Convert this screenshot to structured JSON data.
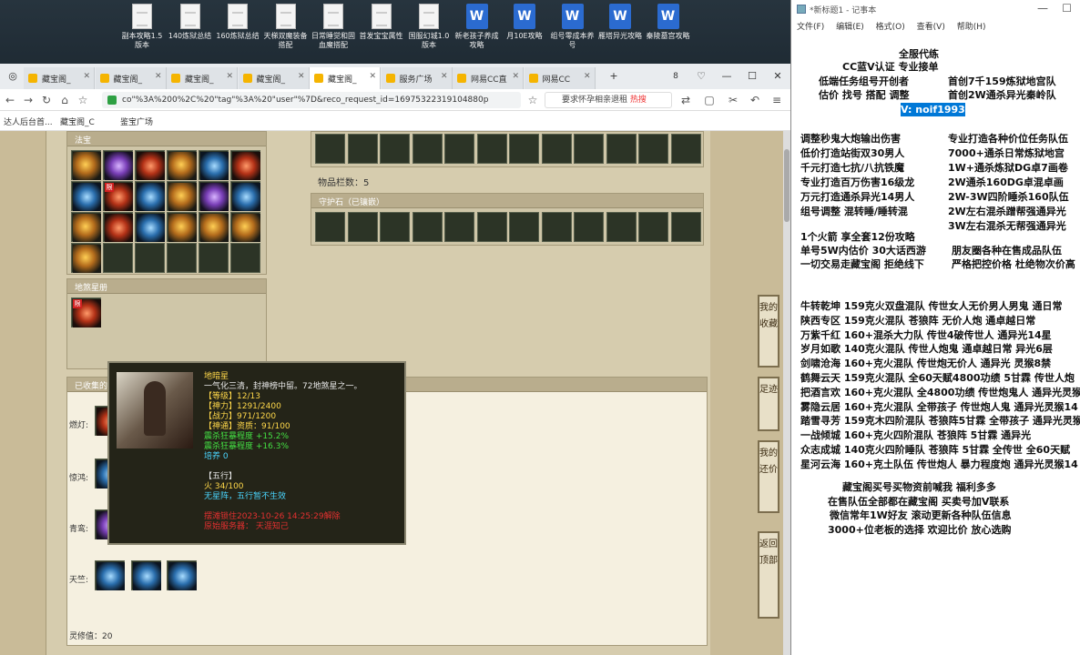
{
  "desktop": {
    "icons": [
      {
        "label": "副本攻略1.5版本",
        "type": "doc"
      },
      {
        "label": "140炼狱总结",
        "type": "doc"
      },
      {
        "label": "160炼狱总结",
        "type": "doc"
      },
      {
        "label": "天梯双魔装备搭配",
        "type": "doc"
      },
      {
        "label": "日常睡觉和固血魔搭配",
        "type": "doc"
      },
      {
        "label": "首发宝宝属性",
        "type": "doc"
      },
      {
        "label": "国服幻城1.0版本",
        "type": "doc"
      },
      {
        "label": "新老孩子养成攻略",
        "type": "word"
      },
      {
        "label": "月10E攻略",
        "type": "word"
      },
      {
        "label": "组号零成本养号",
        "type": "word"
      },
      {
        "label": "雁塔异光攻略",
        "type": "word"
      },
      {
        "label": "秦陵墓宫攻略",
        "type": "word"
      }
    ]
  },
  "browser": {
    "tabs": [
      "藏宝阁_",
      "藏宝阁_",
      "藏宝阁_",
      "藏宝阁_",
      "藏宝阁_",
      "服务广场",
      "网易CC直",
      "网易CC"
    ],
    "active_tab": 4,
    "tab_count": "8",
    "url": "co\"%3A%200%2C%20\"tag\"%3A%20\"user\"%7D&reco_request_id=16975322319104880p",
    "search_text": "要求怀孕相亲退租",
    "search_hot": "热搜",
    "bookmarks": [
      "达人后台首...",
      "藏宝阁_C",
      "鉴宝广场"
    ]
  },
  "game": {
    "treasure_title": "法宝",
    "di_sha_title": "地煞星册",
    "items_count_label": "物品栏数：5",
    "guard_stone_title": "守护石（已镶嵌）",
    "collected_title": "已收集的",
    "rows": [
      "燃灯:",
      "惊鸿:",
      "青鸾:",
      "天竺:"
    ],
    "ling_xiu": "灵修值：20",
    "tooltip": {
      "name": "地暗星",
      "desc": "一气化三清，封神榜中留。72地煞星之一。",
      "level": "【等级】12/13",
      "shen_li": "【神力】1291/2400",
      "zhan_li": "【战力】971/1200",
      "shen_tong": "【神通】资质：91/100",
      "stat1": "震杀狂暴程度 +15.2%",
      "stat2": "震杀狂暴程度 +16.3%",
      "peiyang": "培养 0",
      "wuxing_title": "【五行】",
      "wuxing_value": "火 34/100",
      "wuxing_note": "无星阵，五行暂不生效",
      "time": "摆滩锁住2023-10-26 14:25:29解除",
      "server": "原始服务器： 天涯知己"
    },
    "side_buttons": [
      "我的收藏",
      "足迹",
      "我的还价",
      "返回顶部"
    ]
  },
  "notepad": {
    "title": "*新标题1 - 记事本",
    "menu": [
      "文件(F)",
      "编辑(E)",
      "格式(O)",
      "查看(V)",
      "帮助(H)"
    ],
    "header_lines": [
      "全服代练",
      "CC蓝V认证 专业接单",
      "低端任务组号开创者",
      "首创7千159炼狱地宫队",
      "估价 找号 搭配 调整",
      "首创2W通杀异光秦岭队",
      "V: noif1993"
    ],
    "services": [
      [
        "调整秒鬼大炮输出伤害",
        "专业打造各种价位任务队伍"
      ],
      [
        "低价打造站街双30男人",
        "7000+通杀日常炼狱地宫"
      ],
      [
        "千元打造七抗/八抗铁魔",
        "1W+通杀炼狱DG卓7画卷"
      ],
      [
        "专业打造百万伤害16级龙",
        "2W通杀160DG卓混卓画"
      ],
      [
        "万元打造通杀异光14男人",
        "2W-3W四阶睡杀160队伍"
      ],
      [
        "组号调整 混转睡/睡转混",
        "2W左右混杀蹭帮强通异光"
      ],
      [
        "",
        "3W左右混杀无帮强通异光"
      ]
    ],
    "promo": [
      "1个火箭 享全套12份攻略",
      "单号5W内估价 30大话西游",
      "朋友圈各种在售成品队伍",
      "一切交易走藏宝阁 拒绝线下",
      "严格把控价格 杜绝物次价高"
    ],
    "teams": [
      "牛转乾坤 159克火双盘混队 传世女人无价男人男鬼 通日常",
      "陕西专区 159克火混队 苍狼阵 无价人炮 通卓越日常",
      "万紫千红 160+混杀大力队 传世4破传世人 通异光14星",
      "岁月如歌 140克火混队 传世人炮鬼 通卓越日常 异光6层",
      "剑啸沧海 160+克火混队 传世炮无价人 通异光 灵猴8禁",
      "鹤舞云天 159克火混队 全60天赋4800功绩 5甘霖 传世人炮",
      "把酒言欢 160+克火混队 全4800功绩 传世炮鬼人 通异光灵猴",
      "雾隐云居 160+克火混队 全带孩子 传世炮人鬼 通异光灵猴14",
      "踏雪寻芳 159克木四阶混队 苍狼阵5甘霖 全带孩子 通异光灵猴",
      "一战倾城 160+克火四阶混队 苍狼阵 5甘霖 通异光",
      "众志成城 140克火四阶睡队 苍狼阵 5甘霖 全传世 全60天赋",
      "星河云海 160+克土队伍 传世炮人 暴力程度炮 通异光灵猴14"
    ],
    "footer": [
      "藏宝阁买号买物资前喊我 福利多多",
      "在售队伍全部都在藏宝阁 买卖号加V联系",
      "微信常年1W好友 滚动更新各种队伍信息",
      "3000+位老板的选择 欢迎比价 放心选购"
    ]
  }
}
